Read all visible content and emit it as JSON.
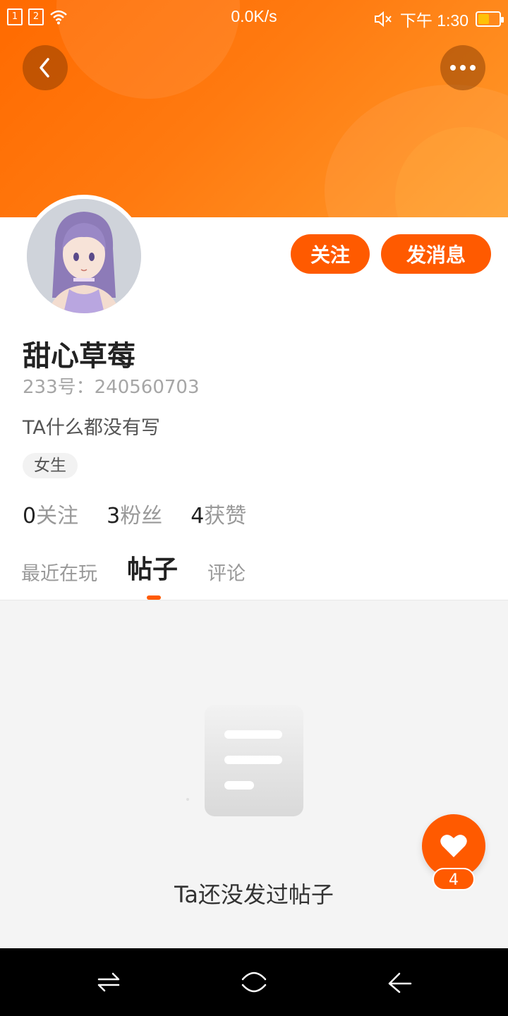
{
  "status_bar": {
    "sim1": "1",
    "sim2": "2",
    "net_speed": "0.0K/s",
    "time": "下午 1:30",
    "battery_level_percent": 55,
    "battery_color": "#ffc107"
  },
  "header": {
    "back_icon": "chevron-left-icon",
    "more_icon": "more-dots-icon"
  },
  "profile": {
    "name": "甜心草莓",
    "uid": "233号：240560703",
    "bio": "TA什么都没有写",
    "gender_tag": "女生",
    "follow_button": "关注",
    "message_button": "发消息"
  },
  "stats": [
    {
      "count": "0",
      "label": "关注"
    },
    {
      "count": "3",
      "label": "粉丝"
    },
    {
      "count": "4",
      "label": "获赞"
    }
  ],
  "tabs": [
    {
      "label": "最近在玩",
      "active": false
    },
    {
      "label": "帖子",
      "active": true
    },
    {
      "label": "评论",
      "active": false
    }
  ],
  "empty_state": {
    "text": "Ta还没发过帖子"
  },
  "like_fab": {
    "count": "4"
  },
  "colors": {
    "accent": "#ff5a00",
    "banner_start": "#ff6a00",
    "banner_end": "#ff9a2a"
  }
}
